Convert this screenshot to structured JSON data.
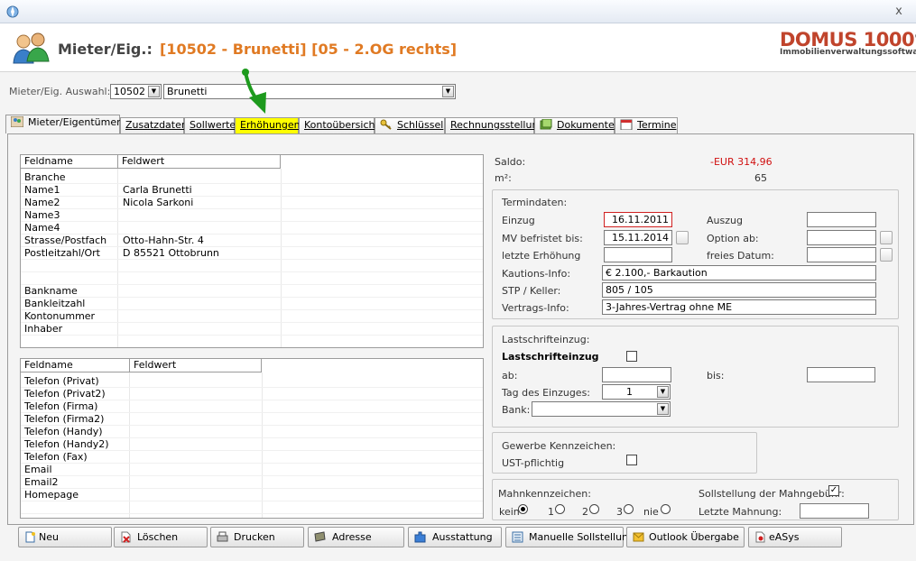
{
  "window": {
    "close_glyph": "x"
  },
  "header": {
    "label": "Mieter/Eig.:",
    "value": "[10502 - Brunetti] [05 - 2.OG rechts]",
    "logo_main": "DOMUS 1000",
    "logo_reg": "®",
    "logo_sub": "Immobilienverwaltungssoftware"
  },
  "selector": {
    "label": "Mieter/Eig. Auswahl:",
    "id": "10502",
    "name": "Brunetti"
  },
  "tabs": [
    {
      "label": "Mieter/Eigentümer",
      "icon": "people-icon"
    },
    {
      "label": "Zusatzdaten"
    },
    {
      "label": "Sollwerte"
    },
    {
      "label": "Erhöhungen"
    },
    {
      "label": "Kontoübersicht"
    },
    {
      "label": "Schlüssel",
      "icon": "key-icon"
    },
    {
      "label": "Rechnungsstellung"
    },
    {
      "label": "Dokumente",
      "icon": "documents-icon"
    },
    {
      "label": "Termine",
      "icon": "calendar-icon"
    }
  ],
  "grid1": {
    "headers": [
      "Feldname",
      "Feldwert"
    ],
    "rows": [
      [
        "Branche",
        ""
      ],
      [
        "Name1",
        "Carla Brunetti"
      ],
      [
        "Name2",
        "Nicola Sarkoni"
      ],
      [
        "Name3",
        ""
      ],
      [
        "Name4",
        ""
      ],
      [
        "Strasse/Postfach",
        "Otto-Hahn-Str. 4"
      ],
      [
        "Postleitzahl/Ort",
        "D 85521 Ottobrunn"
      ],
      [
        "",
        ""
      ],
      [
        "",
        ""
      ],
      [
        "Bankname",
        ""
      ],
      [
        "Bankleitzahl",
        ""
      ],
      [
        "Kontonummer",
        ""
      ],
      [
        "Inhaber",
        ""
      ]
    ]
  },
  "grid2": {
    "headers": [
      "Feldname",
      "Feldwert"
    ],
    "rows": [
      [
        "Telefon (Privat)",
        ""
      ],
      [
        "Telefon (Privat2)",
        ""
      ],
      [
        "Telefon (Firma)",
        ""
      ],
      [
        "Telefon (Firma2)",
        ""
      ],
      [
        "Telefon (Handy)",
        ""
      ],
      [
        "Telefon (Handy2)",
        ""
      ],
      [
        "Telefon (Fax)",
        ""
      ],
      [
        "Email",
        ""
      ],
      [
        "Email2",
        ""
      ],
      [
        "Homepage",
        ""
      ]
    ]
  },
  "saldo": {
    "label": "Saldo:",
    "value": "-EUR 314,96",
    "m2_label": "m²:",
    "m2_value": "65",
    "value_color": "#d01010"
  },
  "termindaten": {
    "title": "Termindaten:",
    "einzug_label": "Einzug",
    "einzug": "16.11.2011",
    "auszug_label": "Auszug",
    "auszug": "",
    "mv_label": "MV befristet bis:",
    "mv": "15.11.2014",
    "option_label": "Option ab:",
    "option": "",
    "erhoehung_label": "letzte Erhöhung",
    "erhoehung": "",
    "freies_label": "freies Datum:",
    "freies": "",
    "kaution_label": "Kautions-Info:",
    "kaution": "€ 2.100,- Barkaution",
    "stp_label": "STP / Keller:",
    "stp": "805 / 105",
    "vertrag_label": "Vertrags-Info:",
    "vertrag": "3-Jahres-Vertrag ohne ME"
  },
  "lastschrift": {
    "title": "Lastschrifteinzug:",
    "check_label": "Lastschrifteinzug",
    "ab_label": "ab:",
    "ab": "",
    "bis_label": "bis:",
    "bis": "",
    "tag_label": "Tag des Einzuges:",
    "tag": "1",
    "bank_label": "Bank:",
    "bank": ""
  },
  "gewerbe": {
    "title": "Gewerbe Kennzeichen:",
    "ust_label": "UST-pflichtig"
  },
  "mahn": {
    "title": "Mahnkennzeichen:",
    "options": [
      "kein",
      "1",
      "2",
      "3",
      "nie"
    ],
    "selected": "kein",
    "soll_label": "Sollstellung der Mahngebühr:",
    "soll_checked": "✓",
    "letzte_label": "Letzte Mahnung:",
    "letzte": ""
  },
  "buttons": [
    {
      "label": "Neu",
      "icon": "new-document-icon"
    },
    {
      "label": "Löschen",
      "icon": "delete-icon"
    },
    {
      "label": "Drucken",
      "icon": "print-icon"
    },
    {
      "label": "Adresse",
      "icon": "address-book-icon"
    },
    {
      "label": "Ausstattung",
      "icon": "puzzle-icon"
    },
    {
      "label": "Manuelle Sollstellung",
      "icon": "ledger-icon"
    },
    {
      "label": "Outlook Übergabe",
      "icon": "outlook-icon"
    },
    {
      "label": "eASys",
      "icon": "easys-icon"
    }
  ],
  "colors": {
    "accent_orange": "#e07a23",
    "logo_red": "#c0442c",
    "highlight_tab": "#ffff00",
    "arrow_green": "#1d9a1d"
  }
}
